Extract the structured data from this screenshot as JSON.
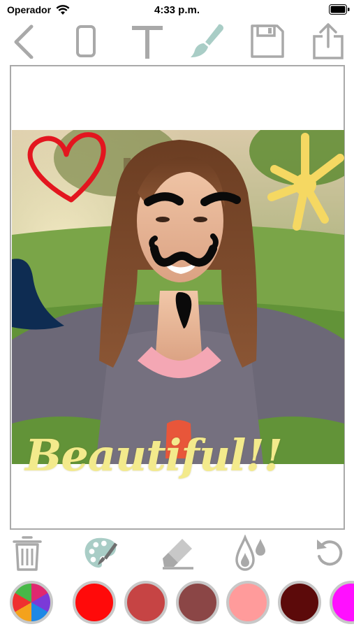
{
  "status_bar": {
    "carrier": "Operador",
    "time": "4:33 p.m."
  },
  "toolbar": {
    "items": [
      {
        "name": "back",
        "icon": "chevron-left-icon"
      },
      {
        "name": "shape",
        "icon": "rounded-rectangle-icon"
      },
      {
        "name": "text",
        "icon": "text-t-icon"
      },
      {
        "name": "brush",
        "icon": "paintbrush-icon",
        "selected": true
      },
      {
        "name": "save",
        "icon": "floppy-disk-icon"
      },
      {
        "name": "share",
        "icon": "share-icon"
      }
    ]
  },
  "canvas": {
    "overlay_text": "Beautiful!!",
    "overlay_text_color": "#f3ea8c",
    "stickers": [
      "heart-doodle",
      "sun-doodle",
      "eyebrows-doodle",
      "mustache-doodle",
      "goatee-doodle",
      "blue-blob"
    ]
  },
  "edit_tools": {
    "items": [
      {
        "name": "delete",
        "icon": "trash-icon"
      },
      {
        "name": "palette",
        "icon": "paint-palette-icon",
        "selected": true
      },
      {
        "name": "eraser",
        "icon": "eraser-icon"
      },
      {
        "name": "opacity",
        "icon": "drops-icon"
      },
      {
        "name": "undo",
        "icon": "undo-icon"
      }
    ]
  },
  "palette": {
    "color_wheel": "multicolor",
    "swatches": [
      "#ff0a0a",
      "#c64444",
      "#8b4646",
      "#ff9b9b",
      "#5c0a0a",
      "#ff10ff"
    ]
  },
  "colors": {
    "icon_gray": "#a9a9a9",
    "accent_teal": "#a9cdc6",
    "frame_border": "#a9a9a9"
  }
}
